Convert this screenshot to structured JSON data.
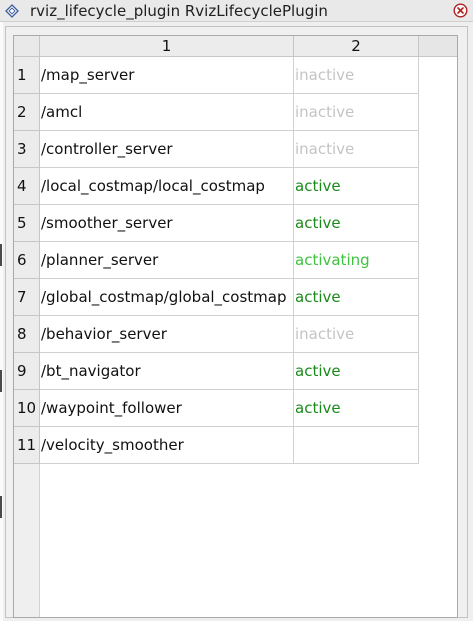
{
  "window": {
    "title": "rviz_lifecycle_plugin RvizLifecyclePlugin",
    "icon": "diamond-app-icon",
    "close_icon": "close-icon"
  },
  "table": {
    "column_headers": [
      "1",
      "2"
    ],
    "rows": [
      {
        "num": "1",
        "node": "/map_server",
        "state": "inactive",
        "state_color": "#c4c4c4"
      },
      {
        "num": "2",
        "node": "/amcl",
        "state": "inactive",
        "state_color": "#c4c4c4"
      },
      {
        "num": "3",
        "node": "/controller_server",
        "state": "inactive",
        "state_color": "#c4c4c4"
      },
      {
        "num": "4",
        "node": "/local_costmap/local_costmap",
        "state": "active",
        "state_color": "#1a8a1a"
      },
      {
        "num": "5",
        "node": "/smoother_server",
        "state": "active",
        "state_color": "#1a8a1a"
      },
      {
        "num": "6",
        "node": "/planner_server",
        "state": "activating",
        "state_color": "#3fc23f"
      },
      {
        "num": "7",
        "node": "/global_costmap/global_costmap",
        "state": "active",
        "state_color": "#1a8a1a"
      },
      {
        "num": "8",
        "node": "/behavior_server",
        "state": "inactive",
        "state_color": "#c4c4c4"
      },
      {
        "num": "9",
        "node": "/bt_navigator",
        "state": "active",
        "state_color": "#1a8a1a"
      },
      {
        "num": "10",
        "node": "/waypoint_follower",
        "state": "active",
        "state_color": "#1a8a1a"
      },
      {
        "num": "11",
        "node": "/velocity_smoother",
        "state": "",
        "state_color": "#1a8a1a"
      }
    ]
  }
}
